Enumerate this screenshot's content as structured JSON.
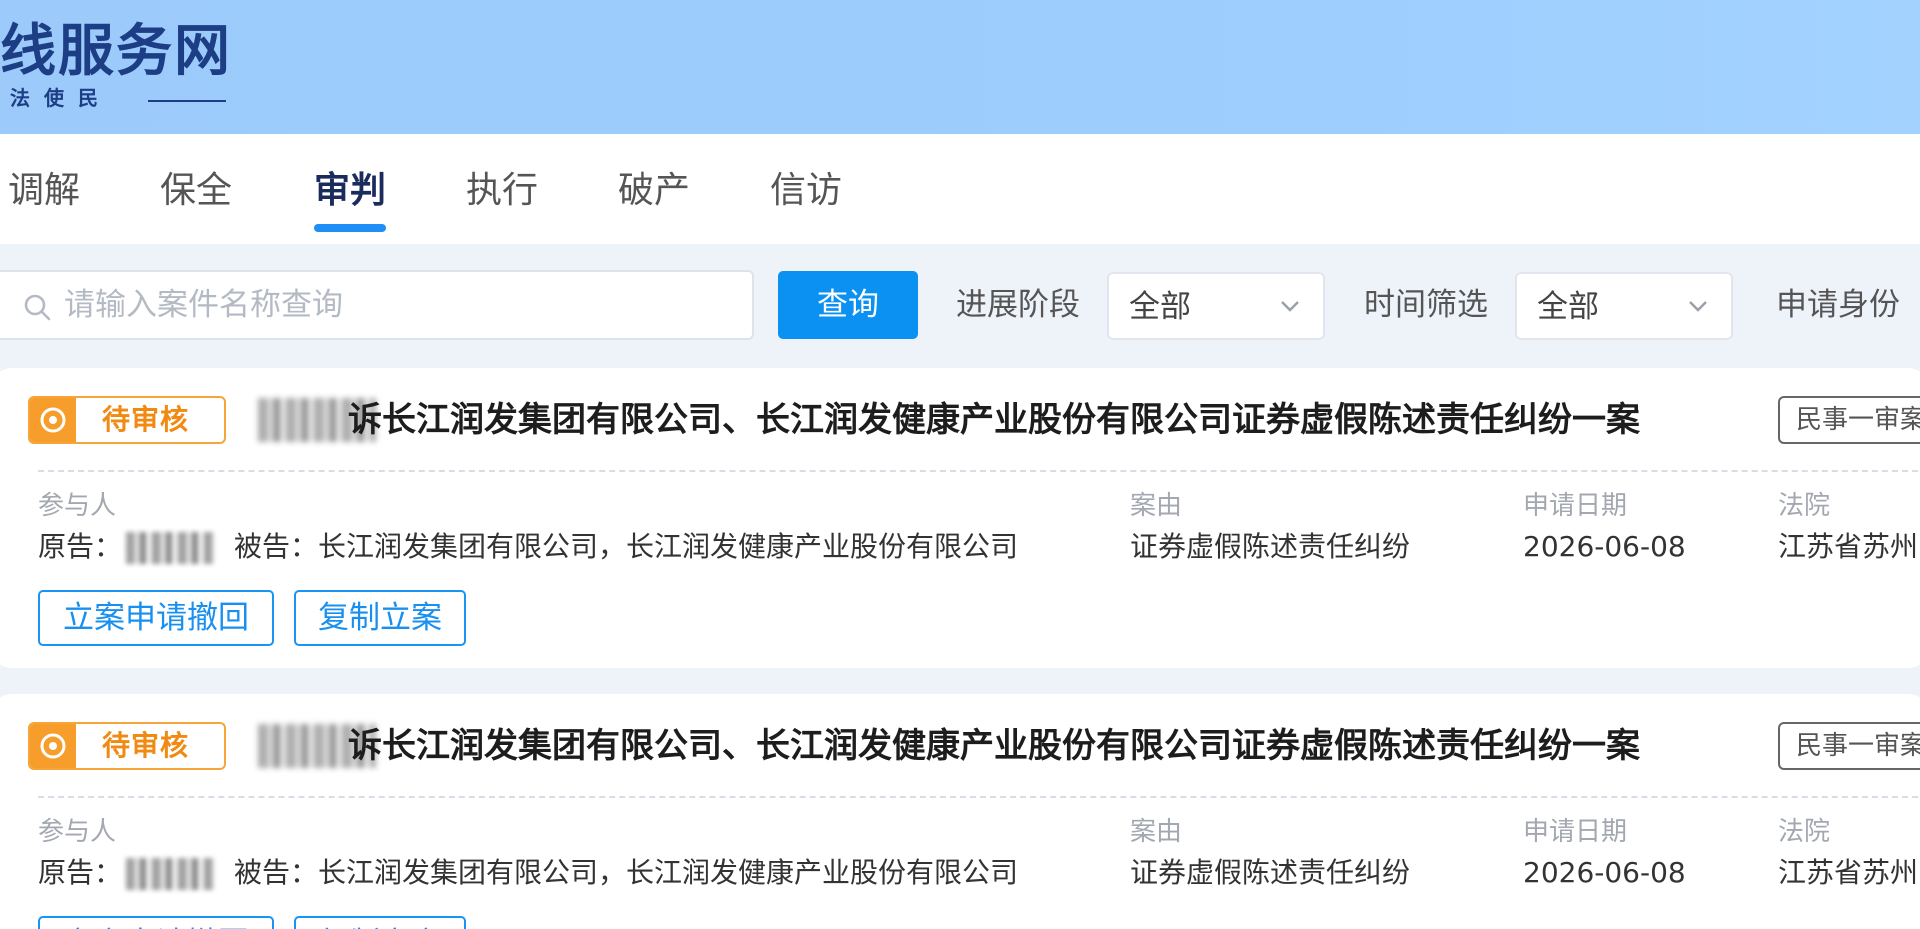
{
  "header": {
    "logo_title": "线服务网",
    "logo_subtitle": "法使民"
  },
  "tabs": [
    {
      "label": "调解",
      "active": false
    },
    {
      "label": "保全",
      "active": false
    },
    {
      "label": "审判",
      "active": true
    },
    {
      "label": "执行",
      "active": false
    },
    {
      "label": "破产",
      "active": false
    },
    {
      "label": "信访",
      "active": false
    }
  ],
  "filters": {
    "search_placeholder": "请输入案件名称查询",
    "search_value": "",
    "query_label": "查询",
    "stage_label": "进展阶段",
    "stage_value": "全部",
    "time_label": "时间筛选",
    "time_value": "全部",
    "identity_label": "申请身份"
  },
  "cases": [
    {
      "status": "待审核",
      "title": "诉长江润发集团有限公司、长江润发健康产业股份有限公司证券虚假陈述责任纠纷一案",
      "type_tag": "民事一审案",
      "participants_label": "参与人",
      "plaintiff_label": "原告：",
      "defendant_text": "被告：长江润发集团有限公司，长江润发健康产业股份有限公司",
      "cause_label": "案由",
      "cause_value": "证券虚假陈述责任纠纷",
      "date_label": "申请日期",
      "date_value": "2026-06-08",
      "court_label": "法院",
      "court_value": "江苏省苏州",
      "actions": [
        "立案申请撤回",
        "复制立案"
      ]
    },
    {
      "status": "待审核",
      "title": "诉长江润发集团有限公司、长江润发健康产业股份有限公司证券虚假陈述责任纠纷一案",
      "type_tag": "民事一审案",
      "participants_label": "参与人",
      "plaintiff_label": "原告：",
      "defendant_text": "被告：长江润发集团有限公司，长江润发健康产业股份有限公司",
      "cause_label": "案由",
      "cause_value": "证券虚假陈述责任纠纷",
      "date_label": "申请日期",
      "date_value": "2026-06-08",
      "court_label": "法院",
      "court_value": "江苏省苏州",
      "actions": [
        "立案申请撤回",
        "复制立案"
      ]
    }
  ],
  "colors": {
    "header_bg": "#9ccbfb",
    "primary": "#0a91f2",
    "status_orange": "#f79d2b",
    "active_tab_text": "#1a2b5c"
  }
}
